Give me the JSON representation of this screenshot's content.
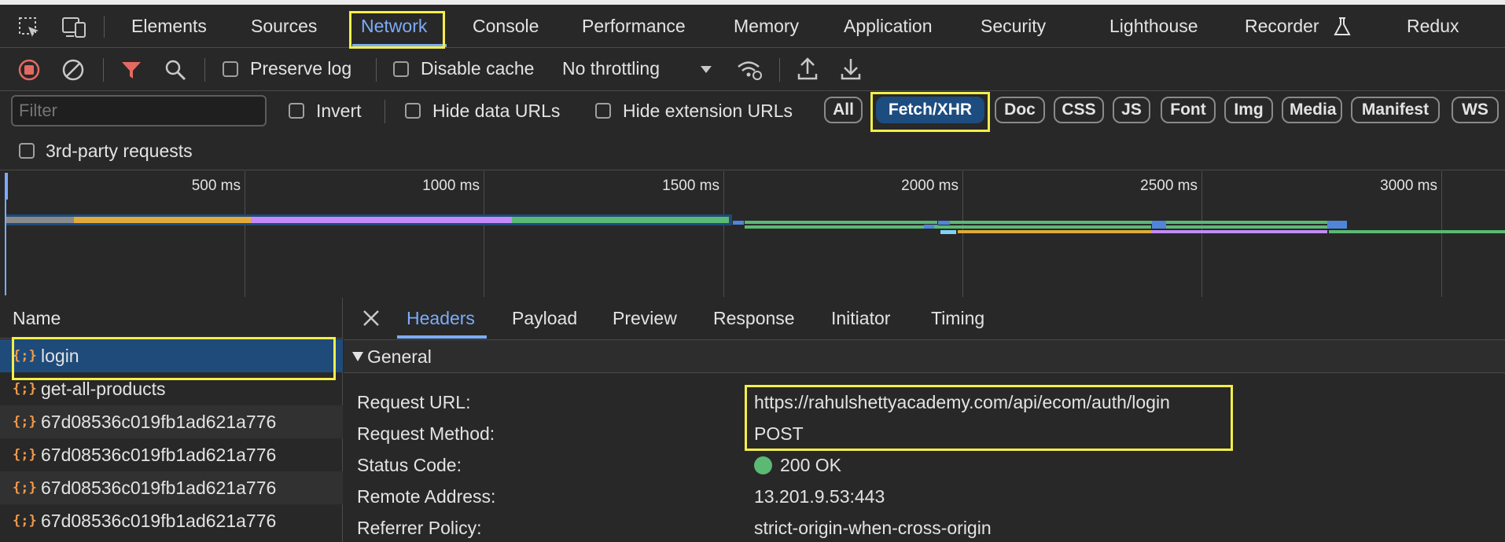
{
  "tabs": {
    "items": [
      "Elements",
      "Sources",
      "Network",
      "Console",
      "Performance",
      "Memory",
      "Application",
      "Security",
      "Lighthouse",
      "Recorder",
      "Redux"
    ],
    "active": "Network"
  },
  "toolbar": {
    "preserve_log": "Preserve log",
    "disable_cache": "Disable cache",
    "throttling": "No throttling"
  },
  "filters": {
    "placeholder": "Filter",
    "invert": "Invert",
    "hide_data_urls": "Hide data URLs",
    "hide_extension_urls": "Hide extension URLs",
    "types": [
      "All",
      "Fetch/XHR",
      "Doc",
      "CSS",
      "JS",
      "Font",
      "Img",
      "Media",
      "Manifest",
      "WS"
    ],
    "active_type": "Fetch/XHR",
    "third_party": "3rd-party requests"
  },
  "timeline": {
    "ticks": [
      "500 ms",
      "1000 ms",
      "1500 ms",
      "2000 ms",
      "2500 ms",
      "3000 ms"
    ]
  },
  "requests": {
    "header": "Name",
    "items": [
      "login",
      "get-all-products",
      "67d08536c019fb1ad621a776",
      "67d08536c019fb1ad621a776",
      "67d08536c019fb1ad621a776",
      "67d08536c019fb1ad621a776"
    ],
    "selected": "login",
    "icon_glyph": "{;}"
  },
  "details": {
    "tabs": [
      "Headers",
      "Payload",
      "Preview",
      "Response",
      "Initiator",
      "Timing"
    ],
    "active_tab": "Headers",
    "section": "General",
    "fields": [
      {
        "key": "Request URL:",
        "value": "https://rahulshettyacademy.com/api/ecom/auth/login"
      },
      {
        "key": "Request Method:",
        "value": "POST"
      },
      {
        "key": "Status Code:",
        "value": "200 OK"
      },
      {
        "key": "Remote Address:",
        "value": "13.201.9.53:443"
      },
      {
        "key": "Referrer Policy:",
        "value": "strict-origin-when-cross-origin"
      }
    ]
  },
  "colors": {
    "accent": "#7cacf8",
    "highlight": "#f3ee4a",
    "status_ok": "#5bb974",
    "record": "#e46962",
    "filter_icon": "#e46962"
  }
}
